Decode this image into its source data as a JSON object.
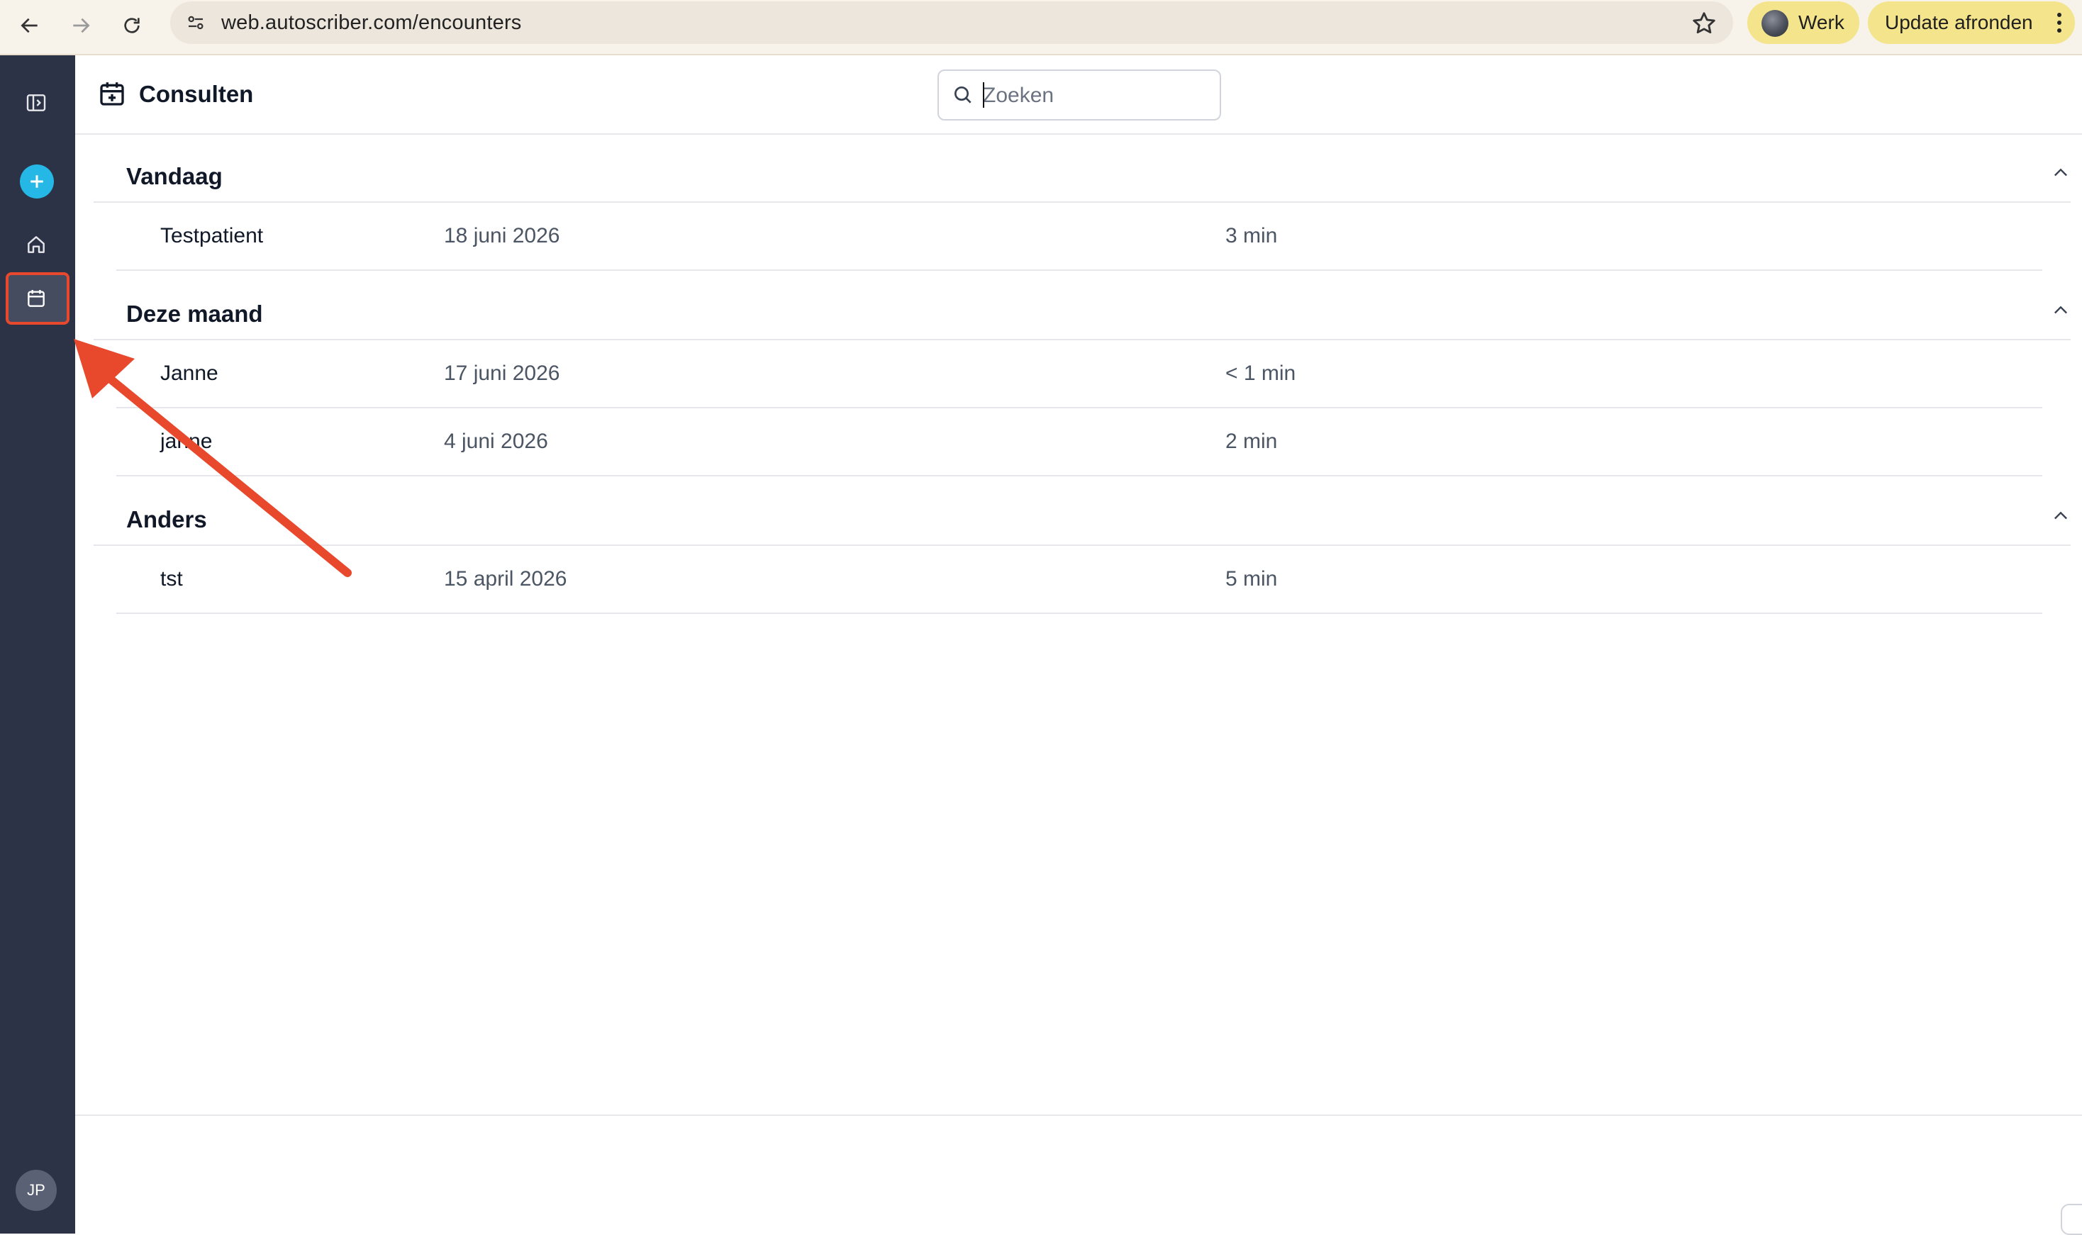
{
  "browser": {
    "url": "web.autoscriber.com/encounters",
    "profile_label": "Werk",
    "update_label": "Update afronden"
  },
  "sidebar": {
    "user_initials": "JP",
    "items": [
      {
        "icon": "sidebar-toggle-icon"
      },
      {
        "icon": "plus-icon"
      },
      {
        "icon": "home-icon"
      },
      {
        "icon": "calendar-icon",
        "active": true
      }
    ]
  },
  "header": {
    "title": "Consulten",
    "search_placeholder": "Zoeken"
  },
  "groups": [
    {
      "title": "Vandaag",
      "rows": [
        {
          "name": "Testpatient",
          "date": "18 juni 2026",
          "duration": "3 min"
        }
      ]
    },
    {
      "title": "Deze maand",
      "rows": [
        {
          "name": "Janne",
          "date": "17 juni 2026",
          "duration": "< 1 min"
        },
        {
          "name": "janne",
          "date": "4 juni 2026",
          "duration": "2 min"
        }
      ]
    },
    {
      "title": "Anders",
      "rows": [
        {
          "name": "tst",
          "date": "15 april 2026",
          "duration": "5 min"
        }
      ]
    }
  ],
  "colors": {
    "sidebar": "#2c3347",
    "accent": "#25b8e6",
    "annotation": "#e8482c",
    "chip": "#f4e48c"
  }
}
